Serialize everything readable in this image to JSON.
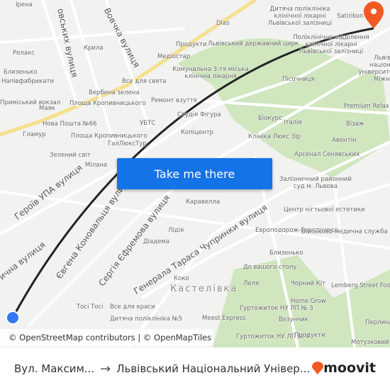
{
  "map": {
    "streets": [
      "Героїв УПА вулиця",
      "Євгена Коновальця вулиця",
      "Сергія Єфремова вулиця",
      "Генерала Тараса Чупринки вулиця",
      "Вовчка вулиця",
      "овських вулиця",
      "ична вулиця"
    ],
    "district": "Кастелівка",
    "labels": [
      "Ірена",
      "Релакс",
      "Близенько",
      "Напівфабрикати",
      "Приміський вокзал",
      "Маяк",
      "Крила",
      "Медіостар",
      "Все для свята",
      "Вербена зелена",
      "Площа Кропивницького",
      "Нова Пошта №66",
      "Гламур",
      "Площа Кропивницького",
      "ГалЛюксТур",
      "Зелений світ",
      "УБТС",
      "Ремонт взуття",
      "Комунальна 3-тя міська клінічна лікарня",
      "Продукти",
      "Dias",
      "Дитяча поліклініка клінічної лікарні Львівської залізниці",
      "Львівський державний цирк",
      "Поліклінічне відділення клінічної лікарні Львівської залізниці",
      "Satirikon",
      "Львівський національний університет Франка, Міжнародн",
      "Пісочниця",
      "Premium Relax Club",
      "Візаж",
      "Біокурс",
      "Італія",
      "Клініка Люкс Зір",
      "Авентін",
      "Арсенал Сенявських",
      "Студія Фігура",
      "Копіцентр",
      "Мілана",
      "Залізничний районний суд м. Львова",
      "Каравелла",
      "Центр нігтьової естетики",
      "Лідія",
      "Діадема",
      "Европодорож-Евротравел",
      "Військово-медична служба СБУ",
      "Близенько",
      "До вашого столу",
      "Коко",
      "Леля",
      "Чорний Кіт",
      "Lemberg Street Food",
      "Home Grow",
      "Tосі Tосі",
      "Все для краси",
      "Гуртожиток НУ ЛП № 3",
      "Meest Express",
      "Везунчик",
      "Перлина",
      "Дитяча поліклініка №5",
      "Гуртожиток НУ ЛП № 9",
      "Продукти",
      "Мотузковий парк"
    ],
    "cta_label": "Take me there",
    "attribution": "© OpenStreetMap contributors | © OpenMapTiles",
    "origin_color": "#3478f6",
    "destination_color": "#f05a22",
    "route_color": "#222222"
  },
  "footer": {
    "origin": "Вул. Максим...",
    "destination": "Львівський Національний Універ...",
    "brand": "moovit"
  }
}
